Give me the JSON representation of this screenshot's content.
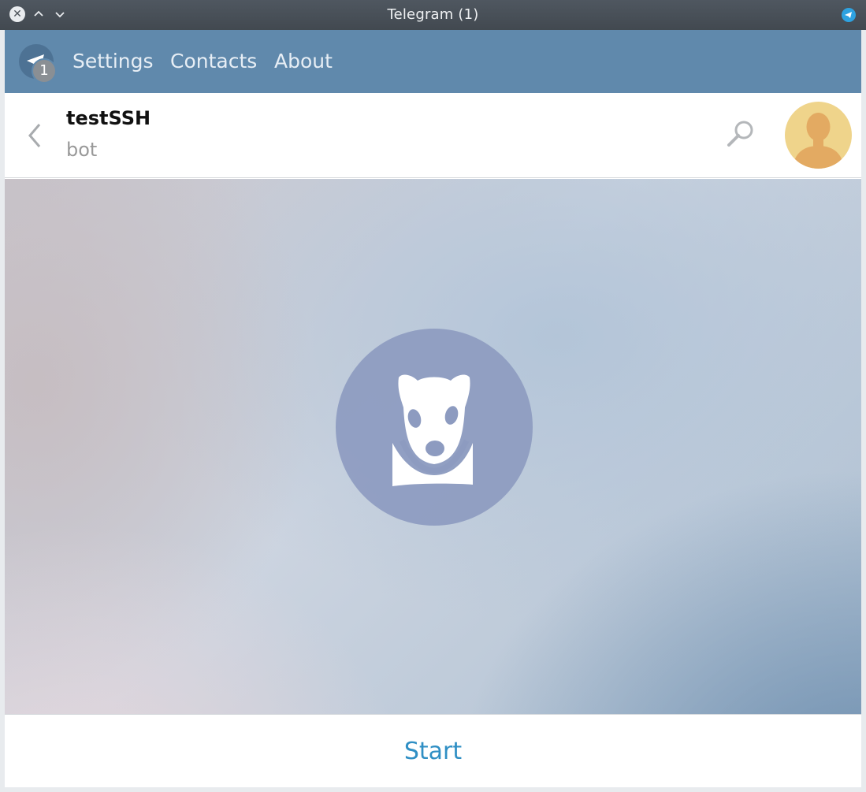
{
  "window": {
    "title": "Telegram (1)"
  },
  "menu": {
    "unread_badge": "1",
    "items": [
      {
        "label": "Settings"
      },
      {
        "label": "Contacts"
      },
      {
        "label": "About"
      }
    ]
  },
  "chat": {
    "peer_name": "testSSH",
    "peer_status": "bot"
  },
  "bottom": {
    "start_label": "Start"
  },
  "colors": {
    "menubar": "#6089ac",
    "accent": "#2f8fc4",
    "avatar": "#efd48b",
    "bot_circle": "#8d9bc0"
  },
  "icons": [
    "close-icon",
    "chevron-up-icon",
    "chevron-down-icon",
    "telegram-tray-icon",
    "telegram-logo-icon",
    "back-arrow-icon",
    "search-icon",
    "user-avatar-icon",
    "bot-dog-icon"
  ]
}
